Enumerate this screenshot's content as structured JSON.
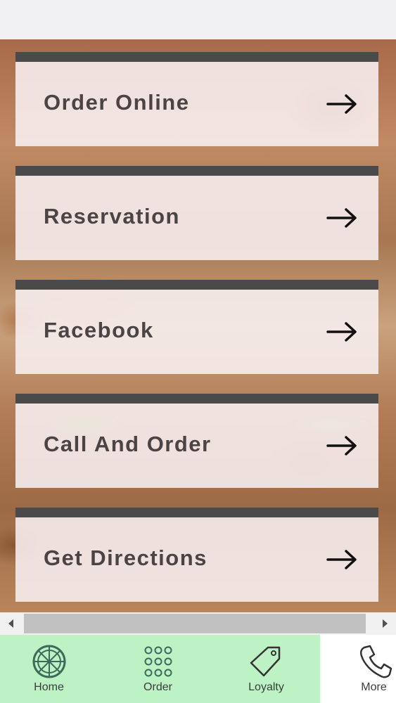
{
  "menu": {
    "items": [
      {
        "label": "Order Online",
        "icon": "arrow-right-icon"
      },
      {
        "label": "Reservation",
        "icon": "arrow-right-icon"
      },
      {
        "label": "Facebook",
        "icon": "arrow-right-icon"
      },
      {
        "label": "Call And Order",
        "icon": "arrow-right-icon"
      },
      {
        "label": "Get Directions",
        "icon": "arrow-right-icon"
      }
    ]
  },
  "tabbar": {
    "tabs": [
      {
        "label": "Home",
        "icon": "pizza-icon"
      },
      {
        "label": "Order",
        "icon": "grid-icon"
      },
      {
        "label": "Loyalty",
        "icon": "tag-icon"
      },
      {
        "label": "More",
        "icon": "phone-icon"
      }
    ],
    "active_color": "#bdf2c4"
  }
}
